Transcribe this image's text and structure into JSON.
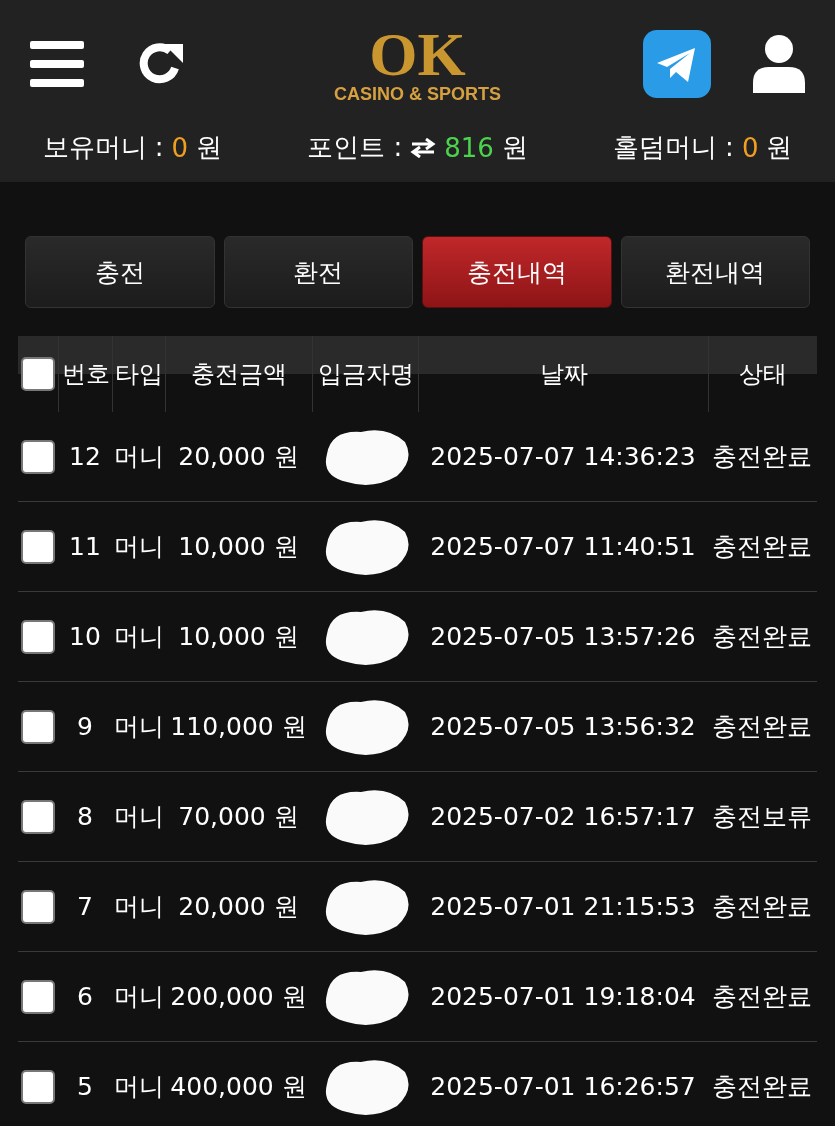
{
  "header": {
    "logo": {
      "mark": "OK",
      "tagline": "CASINO & SPORTS"
    }
  },
  "balances": [
    {
      "label": "보유머니 :",
      "value": "0",
      "unit": "원",
      "kind": "money"
    },
    {
      "label": "포인트 :",
      "value": "816",
      "unit": "원",
      "kind": "point"
    },
    {
      "label": "홀덤머니 :",
      "value": "0",
      "unit": "원",
      "kind": "money"
    }
  ],
  "tabs": [
    {
      "label": "충전",
      "selected": false
    },
    {
      "label": "환전",
      "selected": false
    },
    {
      "label": "충전내역",
      "selected": true
    },
    {
      "label": "환전내역",
      "selected": false
    }
  ],
  "table": {
    "select_all": {
      "checked": false
    },
    "columns": [
      "번호",
      "타입",
      "충전금액",
      "입금자명",
      "날짜",
      "상태"
    ],
    "rows": [
      {
        "checked": false,
        "no": "12",
        "type": "머니",
        "amount": "20,000 원",
        "depositor": {
          "kind": "redacted"
        },
        "date": "2025-07-07 14:36:23",
        "status": "충전완료"
      },
      {
        "checked": false,
        "no": "11",
        "type": "머니",
        "amount": "10,000 원",
        "depositor": {
          "kind": "redacted"
        },
        "date": "2025-07-07 11:40:51",
        "status": "충전완료"
      },
      {
        "checked": false,
        "no": "10",
        "type": "머니",
        "amount": "10,000 원",
        "depositor": {
          "kind": "redacted"
        },
        "date": "2025-07-05 13:57:26",
        "status": "충전완료"
      },
      {
        "checked": false,
        "no": "9",
        "type": "머니",
        "amount": "110,000 원",
        "depositor": {
          "kind": "redacted"
        },
        "date": "2025-07-05 13:56:32",
        "status": "충전완료"
      },
      {
        "checked": false,
        "no": "8",
        "type": "머니",
        "amount": "70,000 원",
        "depositor": {
          "kind": "redacted"
        },
        "date": "2025-07-02 16:57:17",
        "status": "충전보류"
      },
      {
        "checked": false,
        "no": "7",
        "type": "머니",
        "amount": "20,000 원",
        "depositor": {
          "kind": "redacted"
        },
        "date": "2025-07-01 21:15:53",
        "status": "충전완료"
      },
      {
        "checked": false,
        "no": "6",
        "type": "머니",
        "amount": "200,000 원",
        "depositor": {
          "kind": "redacted"
        },
        "date": "2025-07-01 19:18:04",
        "status": "충전완료"
      },
      {
        "checked": false,
        "no": "5",
        "type": "머니",
        "amount": "400,000 원",
        "depositor": {
          "kind": "redacted"
        },
        "date": "2025-07-01 16:26:57",
        "status": "충전완료"
      }
    ]
  }
}
